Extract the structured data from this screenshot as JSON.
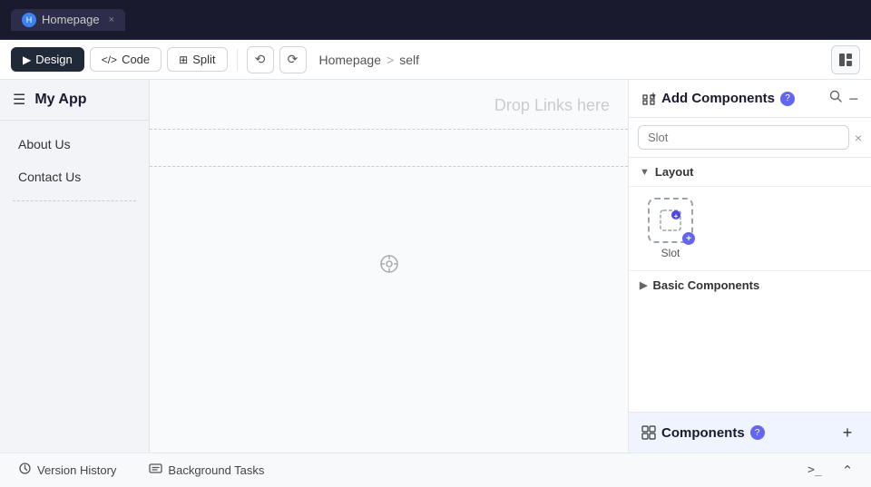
{
  "topbar": {
    "tab_label": "Homepage",
    "tab_close": "×"
  },
  "toolbar": {
    "design_label": "Design",
    "code_label": "Code",
    "split_label": "Split",
    "undo_icon": "⟲",
    "redo_icon": "⟳",
    "breadcrumb_page": "Homepage",
    "breadcrumb_sep": ">",
    "breadcrumb_self": "self"
  },
  "left_sidebar": {
    "hamburger": "☰",
    "app_title": "My App",
    "drop_links": "Drop Links here",
    "nav_items": [
      {
        "label": "About Us"
      },
      {
        "label": "Contact Us"
      }
    ]
  },
  "right_panel": {
    "add_components_title": "Add Components",
    "help_label": "?",
    "search_placeholder": "Slot",
    "search_value": "Slot",
    "clear_icon": "×",
    "layout_section": "Layout",
    "layout_chevron_open": "▼",
    "slot_label": "Slot",
    "basic_section": "Basic Components",
    "basic_chevron": "▶",
    "components_title": "Components",
    "add_icon": "+"
  },
  "bottom_bar": {
    "version_history_label": "Version History",
    "background_tasks_label": "Background Tasks",
    "terminal_icon": ">_",
    "collapse_icon": "⌃"
  }
}
